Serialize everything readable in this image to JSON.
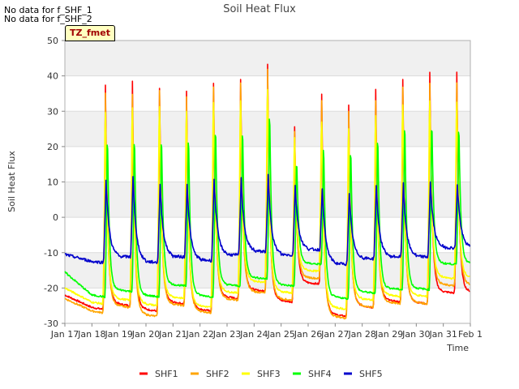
{
  "notes": [
    "No data for f_SHF_1",
    "No data for f_SHF_2"
  ],
  "tz_label": "TZ_fmet",
  "colors": {
    "SHF1": "#ff0000",
    "SHF2": "#ffa500",
    "SHF3": "#ffff00",
    "SHF4": "#00ff00",
    "SHF5": "#0000cc",
    "band": "#f0f0f0",
    "grid": "#dcdcdc",
    "axis": "#b0b0b0"
  },
  "chart_data": {
    "type": "line",
    "title": "Soil Heat Flux",
    "xlabel": "Time",
    "ylabel": "Soil Heat Flux",
    "ylim": [
      -30,
      50
    ],
    "yticks": [
      -30,
      -20,
      -10,
      0,
      10,
      20,
      30,
      40,
      50
    ],
    "xticks": [
      "Jan 17",
      "Jan 18",
      "Jan 19",
      "Jan 20",
      "Jan 21",
      "Jan 22",
      "Jan 23",
      "Jan 24",
      "Jan 25",
      "Jan 26",
      "Jan 27",
      "Jan 28",
      "Jan 29",
      "Jan 30",
      "Jan 31",
      "Feb 1"
    ],
    "xlim": [
      "Jan 17",
      "Feb 1"
    ],
    "grid": true,
    "legend_position": "bottom",
    "days": [
      "Jan 17",
      "Jan 18",
      "Jan 19",
      "Jan 20",
      "Jan 21",
      "Jan 22",
      "Jan 23",
      "Jan 24",
      "Jan 25",
      "Jan 26",
      "Jan 27",
      "Jan 28",
      "Jan 29",
      "Jan 30",
      "Jan 31"
    ],
    "series": [
      {
        "name": "SHF1",
        "daily_max": [
          null,
          37.5,
          38.5,
          36.5,
          35.5,
          38.0,
          39.0,
          43.5,
          25.5,
          35.0,
          31.5,
          36.0,
          39.0,
          41.0,
          41.0
        ],
        "daily_min": [
          -22.0,
          -25.5,
          -24.5,
          -26.0,
          -24.0,
          -26.0,
          -22.5,
          -20.5,
          -23.5,
          -18.5,
          -27.5,
          -25.0,
          -23.5,
          -24.0,
          -21.0
        ]
      },
      {
        "name": "SHF2",
        "daily_max": [
          null,
          35.0,
          35.0,
          36.0,
          34.0,
          37.0,
          38.0,
          42.0,
          24.0,
          33.0,
          30.0,
          33.0,
          37.0,
          38.0,
          38.0
        ],
        "daily_min": [
          -23.0,
          -26.5,
          -25.0,
          -27.5,
          -24.5,
          -26.5,
          -23.0,
          -21.0,
          -23.0,
          -17.0,
          -28.0,
          -25.0,
          -24.0,
          -24.0,
          -19.0
        ]
      },
      {
        "name": "SHF3",
        "daily_max": [
          null,
          36.0,
          38.0,
          38.0,
          37.0,
          39.0,
          39.5,
          43.0,
          27.0,
          33.5,
          31.0,
          35.0,
          38.5,
          39.0,
          39.0
        ],
        "daily_min": [
          -20.0,
          -24.0,
          -23.0,
          -24.5,
          -22.5,
          -25.0,
          -21.0,
          -18.0,
          -21.0,
          -15.0,
          -25.5,
          -23.0,
          -22.0,
          -22.0,
          -17.0
        ]
      },
      {
        "name": "SHF4",
        "daily_max": [
          null,
          27.5,
          27.5,
          27.5,
          28.0,
          31.0,
          30.0,
          35.5,
          20.0,
          24.5,
          24.5,
          28.0,
          32.0,
          32.0,
          30.5
        ],
        "daily_min": [
          -15.5,
          -22.0,
          -20.5,
          -22.0,
          -19.0,
          -22.0,
          -19.0,
          -17.0,
          -19.0,
          -13.0,
          -22.5,
          -21.0,
          -20.0,
          -20.0,
          -13.0
        ]
      },
      {
        "name": "SHF5",
        "daily_max": [
          null,
          10.5,
          11.5,
          9.5,
          9.5,
          11.0,
          11.0,
          12.0,
          9.0,
          8.5,
          6.5,
          9.0,
          9.5,
          10.0,
          9.5
        ],
        "daily_min": [
          -10.5,
          -12.5,
          -11.0,
          -12.5,
          -11.0,
          -12.0,
          -10.5,
          -9.5,
          -10.5,
          -9.0,
          -13.0,
          -11.5,
          -11.0,
          -11.0,
          -8.5
        ]
      }
    ]
  }
}
